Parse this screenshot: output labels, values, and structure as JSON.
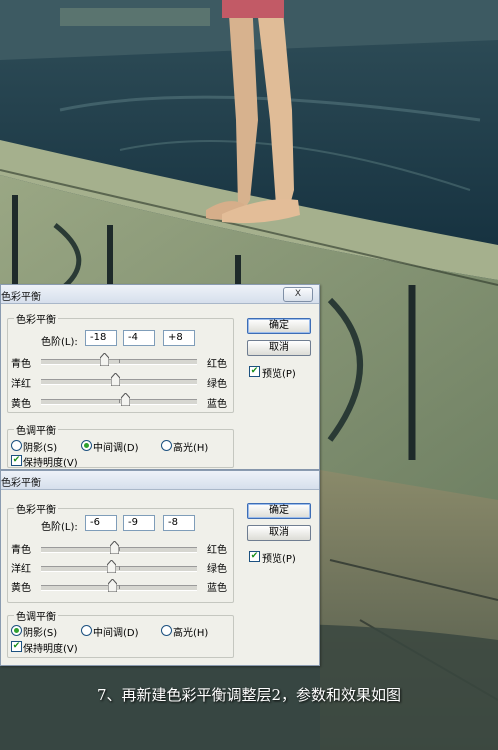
{
  "dialog1": {
    "title": "色彩平衡",
    "close": "X",
    "group_color_balance": "色彩平衡",
    "levels_label": "色阶(L):",
    "levels": [
      "-18",
      "-4",
      "+8"
    ],
    "sliders": [
      {
        "left": "青色",
        "right": "红色",
        "value": -18
      },
      {
        "left": "洋红",
        "right": "绿色",
        "value": -4
      },
      {
        "left": "黄色",
        "right": "蓝色",
        "value": 8
      }
    ],
    "ok": "确定",
    "cancel": "取消",
    "preview": "预览(P)",
    "preview_checked": true,
    "group_tone_balance": "色调平衡",
    "tones": [
      "阴影(S)",
      "中间调(D)",
      "高光(H)"
    ],
    "tone_selected": 1,
    "preserve": "保持明度(V)",
    "preserve_checked": true
  },
  "dialog2": {
    "title": "色彩平衡",
    "group_color_balance": "色彩平衡",
    "levels_label": "色阶(L):",
    "levels": [
      "-6",
      "-9",
      "-8"
    ],
    "sliders": [
      {
        "left": "青色",
        "right": "红色",
        "value": -6
      },
      {
        "left": "洋红",
        "right": "绿色",
        "value": -9
      },
      {
        "left": "黄色",
        "right": "蓝色",
        "value": -8
      }
    ],
    "ok": "确定",
    "cancel": "取消",
    "preview": "预览(P)",
    "preview_checked": true,
    "group_tone_balance": "色调平衡",
    "tones": [
      "阴影(S)",
      "中间调(D)",
      "高光(H)"
    ],
    "tone_selected": 0,
    "preserve": "保持明度(V)",
    "preserve_checked": true
  },
  "caption": "7、再新建色彩平衡调整层2，参数和效果如图",
  "colors": {
    "water": "#1f3a4a",
    "stone": "#8c9a78",
    "dialog_bg": "#f0f0ea",
    "title_gradient_top": "#eef2f8"
  }
}
